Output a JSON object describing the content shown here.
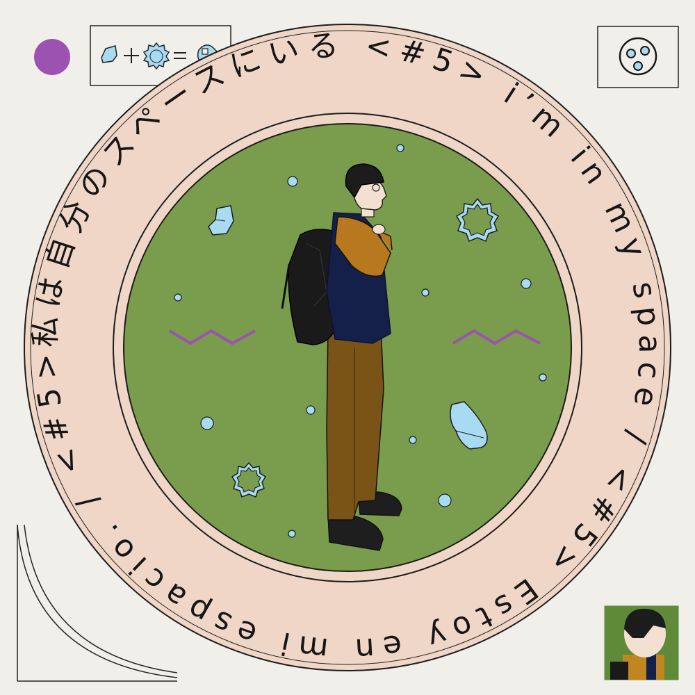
{
  "ring": {
    "text": "私は自分のスペースにいる <#5> i’m in my space / <#5> Estoy en mi espacio. / <#5> "
  },
  "formula": {
    "parts": [
      "sock-icon",
      "plus",
      "badge-icon",
      "equals",
      "mitten-icon"
    ]
  },
  "colors": {
    "background": "#f1efea",
    "ring": "#efd6c7",
    "green": "#7a9c4d",
    "purple": "#9b52b0",
    "lightblue": "#a8daf1",
    "ink": "#161616"
  }
}
